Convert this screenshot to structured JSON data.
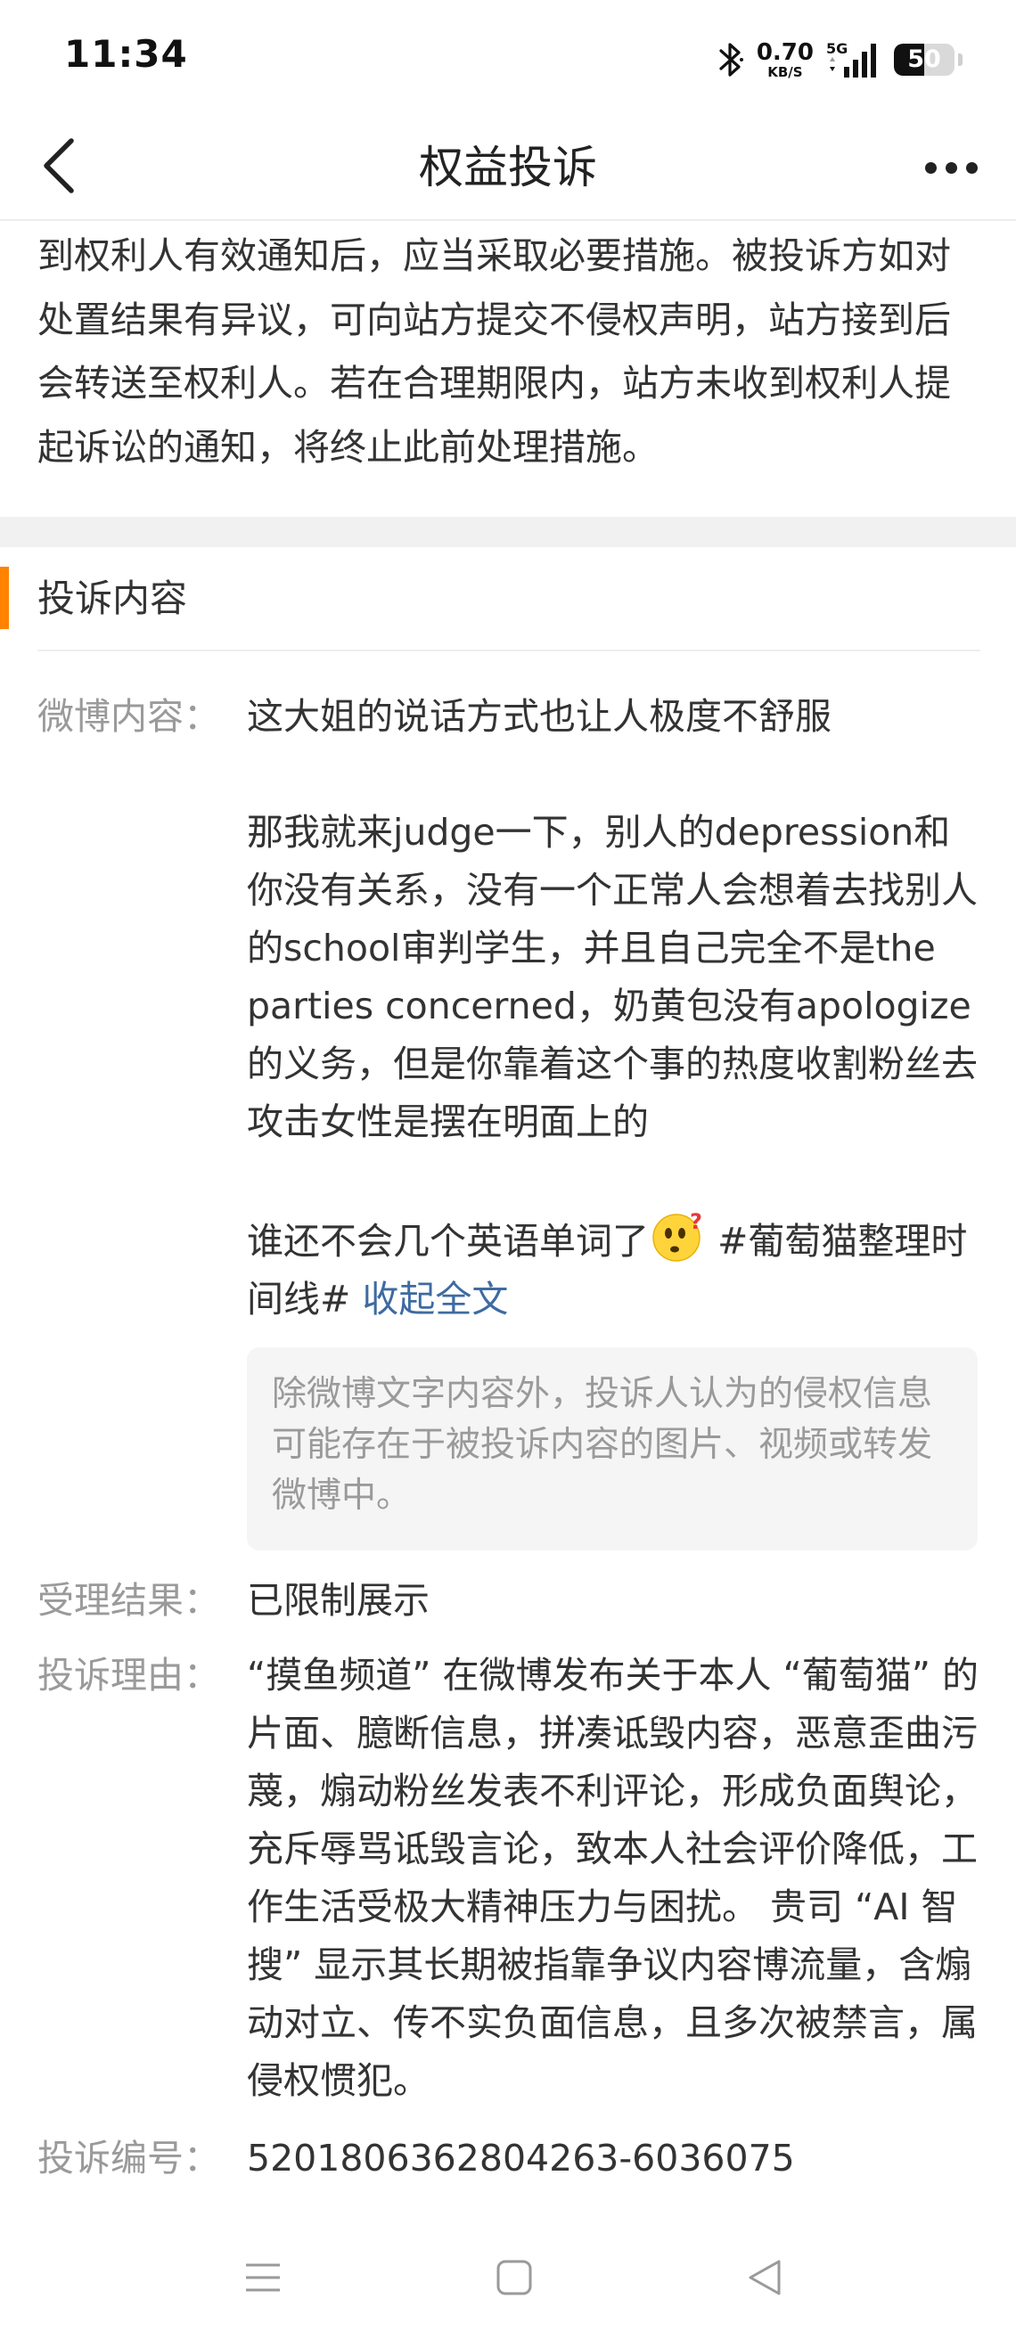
{
  "status_bar": {
    "time": "11:34",
    "net_speed_value": "0.70",
    "net_speed_unit": "KB/S",
    "network_type": "5G",
    "battery": "50",
    "battery_level": 0.5,
    "icons": [
      "bluetooth-icon",
      "signal-icon",
      "battery-icon"
    ]
  },
  "nav": {
    "title": "权益投诉",
    "back_icon": "chevron-left-icon",
    "more_icon": "more-dots-icon"
  },
  "notice": {
    "text": "到权利人有效通知后，应当采取必要措施。被投诉方如对处置结果有异议，可向站方提交不侵权声明，站方接到后会转送至权利人。若在合理期限内，站方未收到权利人提起诉讼的通知，将终止此前处理措施。"
  },
  "complaint": {
    "section_title": "投诉内容",
    "accent_color": "#ff8200",
    "weibo_label": "微博内容：",
    "weibo_para1": "这大姐的说话方式也让人极度不舒服",
    "weibo_para2": "那我就来judge一下，别人的depression和你没有关系，没有一个正常人会想着去找别人的school审判学生，并且自己完全不是the parties concerned，奶黄包没有apologize的义务，但是你靠着这个事的热度收割粉丝去攻击女性是摆在明面上的",
    "weibo_para3_before_emoji": "谁还不会几个英语单词了",
    "weibo_emoji": "thinking-face-icon",
    "weibo_para3_after_emoji": " #葡萄猫整理时间线# ",
    "collapse_link": "收起全文",
    "link_color": "#3e6ba1",
    "disclaimer": "除微博文字内容外，投诉人认为的侵权信息可能存在于被投诉内容的图片、视频或转发微博中。",
    "result_label": "受理结果：",
    "result_value": "已限制展示",
    "reason_label": "投诉理由：",
    "reason_value": "“摸鱼频道” 在微博发布关于本人 “葡萄猫” 的片面、臆断信息，拼凑诋毁内容，恶意歪曲污蔑，煽动粉丝发表不利评论，形成负面舆论，充斥辱骂诋毁言论，致本人社会评价降低，工作生活受极大精神压力与困扰。 贵司 “AI 智搜” 显示其长期被指靠争议内容博流量，含煽动对立、传不实负面信息，且多次被禁言，属侵权惯犯。",
    "number_label": "投诉编号：",
    "number_value": "5201806362804263-6036075"
  },
  "bottom_nav": {
    "icons": [
      "menu-icon",
      "home-square-icon",
      "back-triangle-icon"
    ]
  }
}
